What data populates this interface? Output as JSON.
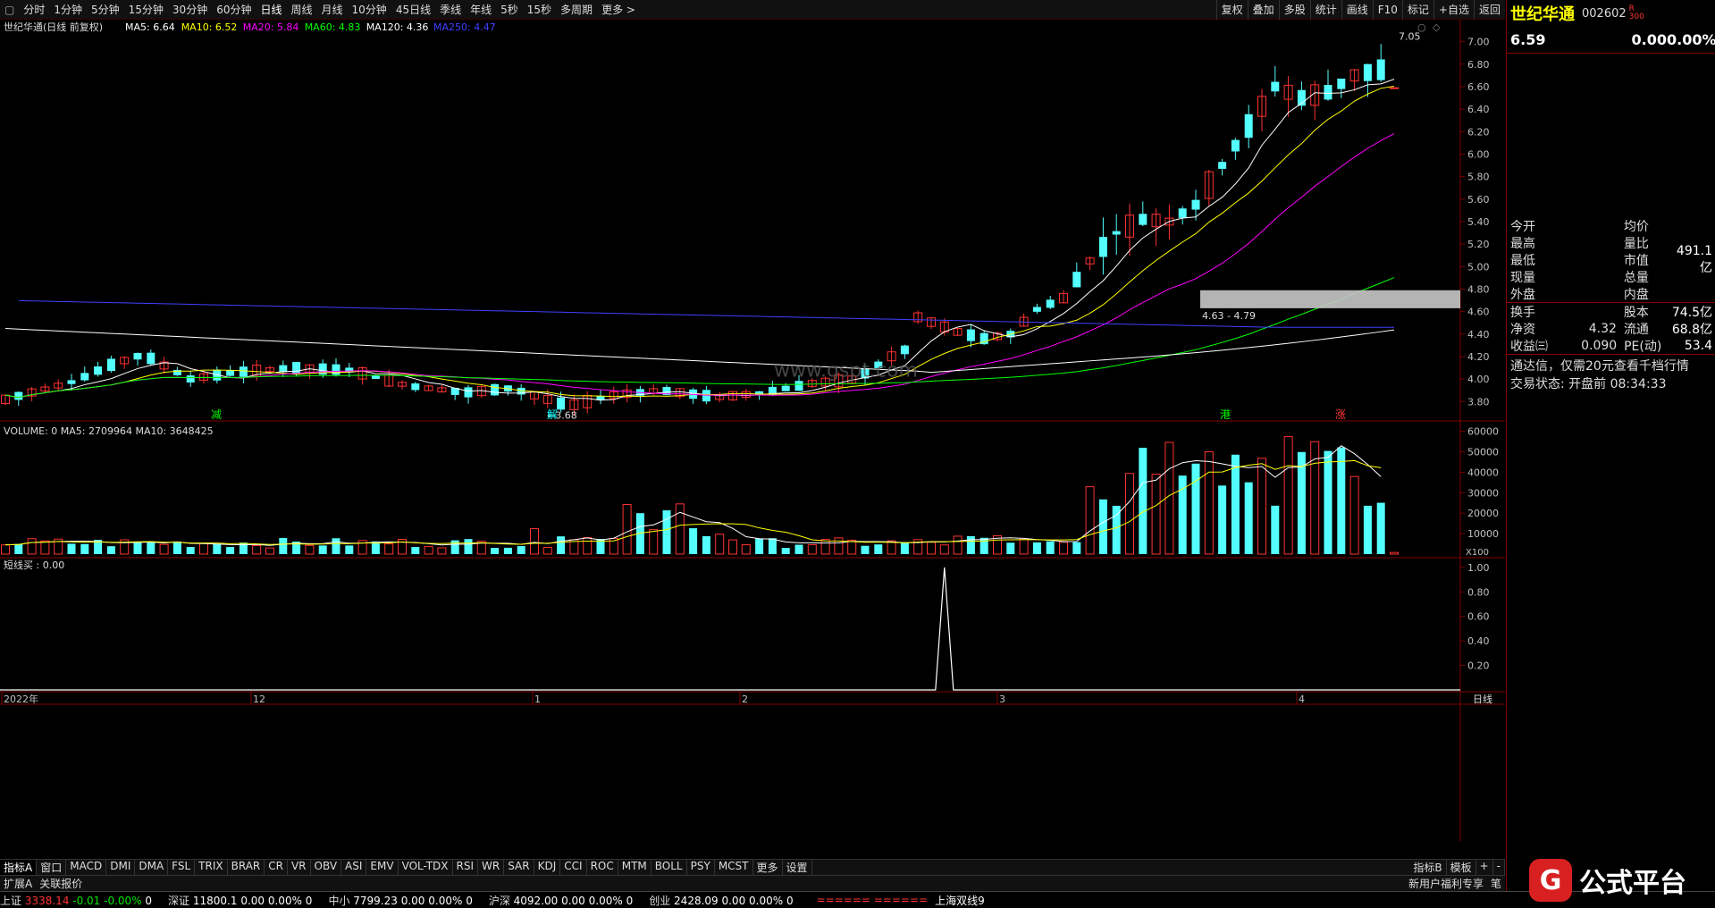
{
  "topbar": {
    "periods": [
      "分时",
      "1分钟",
      "5分钟",
      "15分钟",
      "30分钟",
      "60分钟",
      "日线",
      "周线",
      "月线",
      "10分钟",
      "45日线",
      "季线",
      "年线",
      "5秒",
      "15秒",
      "多周期",
      "更多 >"
    ],
    "active_period": "日线",
    "right_buttons": [
      "复权",
      "叠加",
      "多股",
      "统计",
      "画线",
      "F10",
      "标记",
      "+自选",
      "返回"
    ]
  },
  "main_chart": {
    "title": "世纪华通(日线 前复权)",
    "ma_legend": [
      {
        "label": "MA5: 6.64",
        "color": "#ffffff"
      },
      {
        "label": "MA10: 6.52",
        "color": "#ffff00"
      },
      {
        "label": "MA20: 5.84",
        "color": "#ff00ff"
      },
      {
        "label": "MA60: 4.83",
        "color": "#00ff00"
      },
      {
        "label": "MA120: 4.36",
        "color": "#ffffff"
      },
      {
        "label": "MA250: 4.47",
        "color": "#4040ff"
      }
    ],
    "y_ticks": [
      "7.00",
      "6.80",
      "6.60",
      "6.40",
      "6.20",
      "6.00",
      "5.80",
      "5.60",
      "5.40",
      "5.20",
      "5.00",
      "4.80",
      "4.60",
      "4.40",
      "4.20",
      "4.00",
      "3.80"
    ],
    "high_label": "7.05",
    "low_label": "3.68",
    "range_label": "4.63 - 4.79",
    "markers": [
      {
        "text": "减",
        "color": "#00ff00"
      },
      {
        "text": "解",
        "color": "#00ffff"
      },
      {
        "text": "港",
        "color": "#00ff00"
      },
      {
        "text": "涨",
        "color": "#ff3333"
      }
    ],
    "watermark": "www.gspt.com"
  },
  "volume_chart": {
    "legend": "VOLUME: 0  MA5: 2709964  MA10: 3648425",
    "y_ticks": [
      "60000",
      "50000",
      "40000",
      "30000",
      "20000",
      "10000"
    ],
    "unit": "X100"
  },
  "indicator_chart": {
    "legend": "短线买 : 0.00",
    "y_ticks": [
      "1.00",
      "0.80",
      "0.60",
      "0.40",
      "0.20"
    ]
  },
  "x_axis": {
    "labels": [
      "2022年",
      "12",
      "1",
      "2",
      "3",
      "4"
    ],
    "period_label": "日线"
  },
  "tabs": [
    "指标A",
    "窗口",
    "MACD",
    "DMI",
    "DMA",
    "FSL",
    "TRIX",
    "BRAR",
    "CR",
    "VR",
    "OBV",
    "ASI",
    "EMV",
    "VOL-TDX",
    "RSI",
    "WR",
    "SAR",
    "KDJ",
    "CCI",
    "ROC",
    "MTM",
    "BOLL",
    "PSY",
    "MCST",
    "更多",
    "设置"
  ],
  "tabs_right": [
    "指标B",
    "模板",
    "+",
    "-"
  ],
  "tabs2": [
    "扩展A",
    "关联报价"
  ],
  "tabs2_right": [
    "新用户福利专享",
    "笔"
  ],
  "right_panel": {
    "name": "世纪华通",
    "code": "002602",
    "mark": "R\n300",
    "price": "6.59",
    "change": "0.00",
    "change_pct": "0.00%",
    "rows": [
      {
        "l1": "今开",
        "v1": "",
        "l2": "均价",
        "v2": ""
      },
      {
        "l1": "最高",
        "v1": "",
        "l2": "量比",
        "v2": ""
      },
      {
        "l1": "最低",
        "v1": "",
        "l2": "市值",
        "v2": "491.1亿"
      },
      {
        "l1": "现量",
        "v1": "",
        "l2": "总量",
        "v2": ""
      },
      {
        "l1": "外盘",
        "v1": "",
        "l2": "内盘",
        "v2": ""
      }
    ],
    "rows2": [
      {
        "l1": "换手",
        "v1": "",
        "l2": "股本",
        "v2": "74.5亿"
      },
      {
        "l1": "净资",
        "v1": "4.32",
        "l2": "流通",
        "v2": "68.8亿"
      },
      {
        "l1": "收益㈢",
        "v1": "0.090",
        "l2": "PE(动)",
        "v2": "53.4"
      }
    ],
    "info1": "通达信，仅需20元查看千档行情",
    "info2": "交易状态: 开盘前 08:34:33"
  },
  "status_bar": [
    {
      "name": "上证",
      "val": "3338.14",
      "chg": "-0.01",
      "pct": "-0.00%",
      "vol": "0"
    },
    {
      "name": "深证",
      "val": "11800.1",
      "chg": "0.00",
      "pct": "0.00%",
      "vol": "0"
    },
    {
      "name": "中小",
      "val": "7799.23",
      "chg": "0.00",
      "pct": "0.00%",
      "vol": "0"
    },
    {
      "name": "沪深",
      "val": "4092.00",
      "chg": "0.00",
      "pct": "0.00%",
      "vol": "0"
    },
    {
      "name": "创业",
      "val": "2428.09",
      "chg": "0.00",
      "pct": "0.00%",
      "vol": "0"
    }
  ],
  "status_extra": "上海双线9",
  "logo_text": "公式平台",
  "logo_letter": "G"
}
